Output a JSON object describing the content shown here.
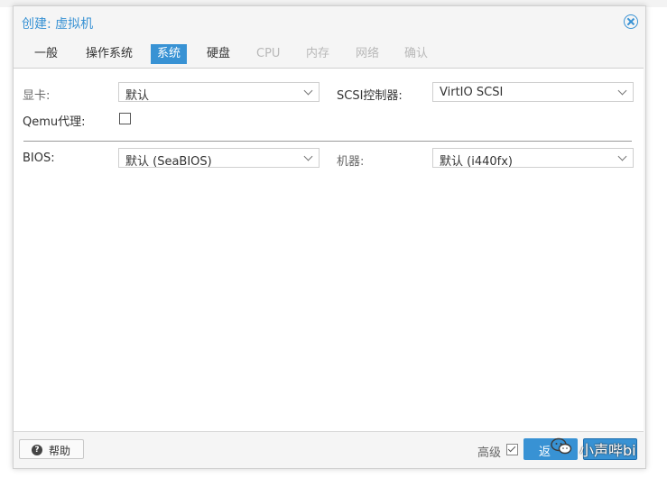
{
  "dialog": {
    "title": "创建: 虚拟机"
  },
  "tabs": [
    {
      "label": "一般",
      "state": "normal"
    },
    {
      "label": "操作系统",
      "state": "normal"
    },
    {
      "label": "系统",
      "state": "active"
    },
    {
      "label": "硬盘",
      "state": "normal"
    },
    {
      "label": "CPU",
      "state": "disabled"
    },
    {
      "label": "内存",
      "state": "disabled"
    },
    {
      "label": "网络",
      "state": "disabled"
    },
    {
      "label": "确认",
      "state": "disabled"
    }
  ],
  "form": {
    "graphic_card": {
      "label": "显卡:",
      "value": "默认"
    },
    "scsi_controller": {
      "label": "SCSI控制器:",
      "value": "VirtIO SCSI"
    },
    "qemu_agent": {
      "label": "Qemu代理:",
      "checked": false
    },
    "bios": {
      "label": "BIOS:",
      "value": "默认 (SeaBIOS)"
    },
    "machine": {
      "label": "机器:",
      "value": "默认 (i440fx)"
    }
  },
  "footer": {
    "help_label": "帮助",
    "advanced_label": "高级",
    "advanced_checked": true,
    "back_label": "返"
  },
  "watermark": {
    "text": "小声哔bi"
  },
  "colors": {
    "accent": "#3892d4"
  }
}
